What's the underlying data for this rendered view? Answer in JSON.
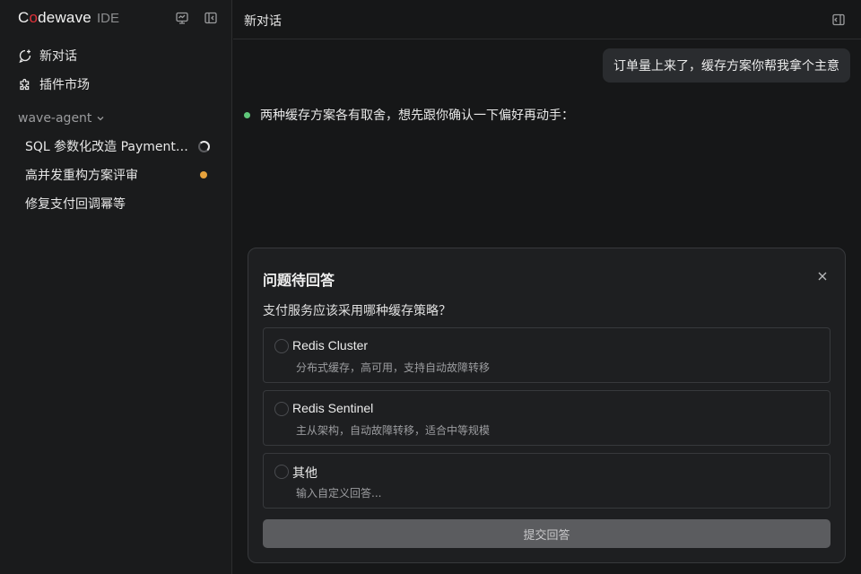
{
  "brand": {
    "name_prefix": "C",
    "name_ring": "o",
    "name_suffix": "dewave",
    "suffix": "IDE"
  },
  "sidebar": {
    "nav": [
      {
        "label": "新对话",
        "icon": "new-chat-icon"
      },
      {
        "label": "插件市场",
        "icon": "puzzle-icon"
      }
    ],
    "group": {
      "label": "wave-agent",
      "icon": "chevron-down-icon"
    },
    "sessions": [
      {
        "label": "SQL 参数化改造 PaymentS…",
        "status": "running"
      },
      {
        "label": "高并发重构方案评审",
        "status": "pending"
      },
      {
        "label": "修复支付回调幂等",
        "status": ""
      }
    ],
    "top_icons": [
      "monitor-icon",
      "collapse-sidebar-icon"
    ]
  },
  "topbar": {
    "title": "新对话",
    "icon": "panel-toggle-icon"
  },
  "chat": {
    "user_message": "订单量上来了，缓存方案你帮我拿个主意",
    "assistant_message": "两种缓存方案各有取舍，想先跟你确认一下偏好再动手："
  },
  "question_card": {
    "title": "问题待回答",
    "question": "支付服务应该采用哪种缓存策略？",
    "options": [
      {
        "title": "Redis Cluster",
        "desc": "分布式缓存，高可用，支持自动故障转移"
      },
      {
        "title": "Redis Sentinel",
        "desc": "主从架构，自动故障转移，适合中等规模"
      },
      {
        "title": "其他",
        "desc": "输入自定义回答..."
      }
    ],
    "submit_label": "提交回答"
  },
  "colors": {
    "accent_ring": "#e0323a",
    "status_pending": "#e6a23c",
    "assistant_dot": "#5fc77a",
    "submit_bg": "#5b5c5f"
  }
}
